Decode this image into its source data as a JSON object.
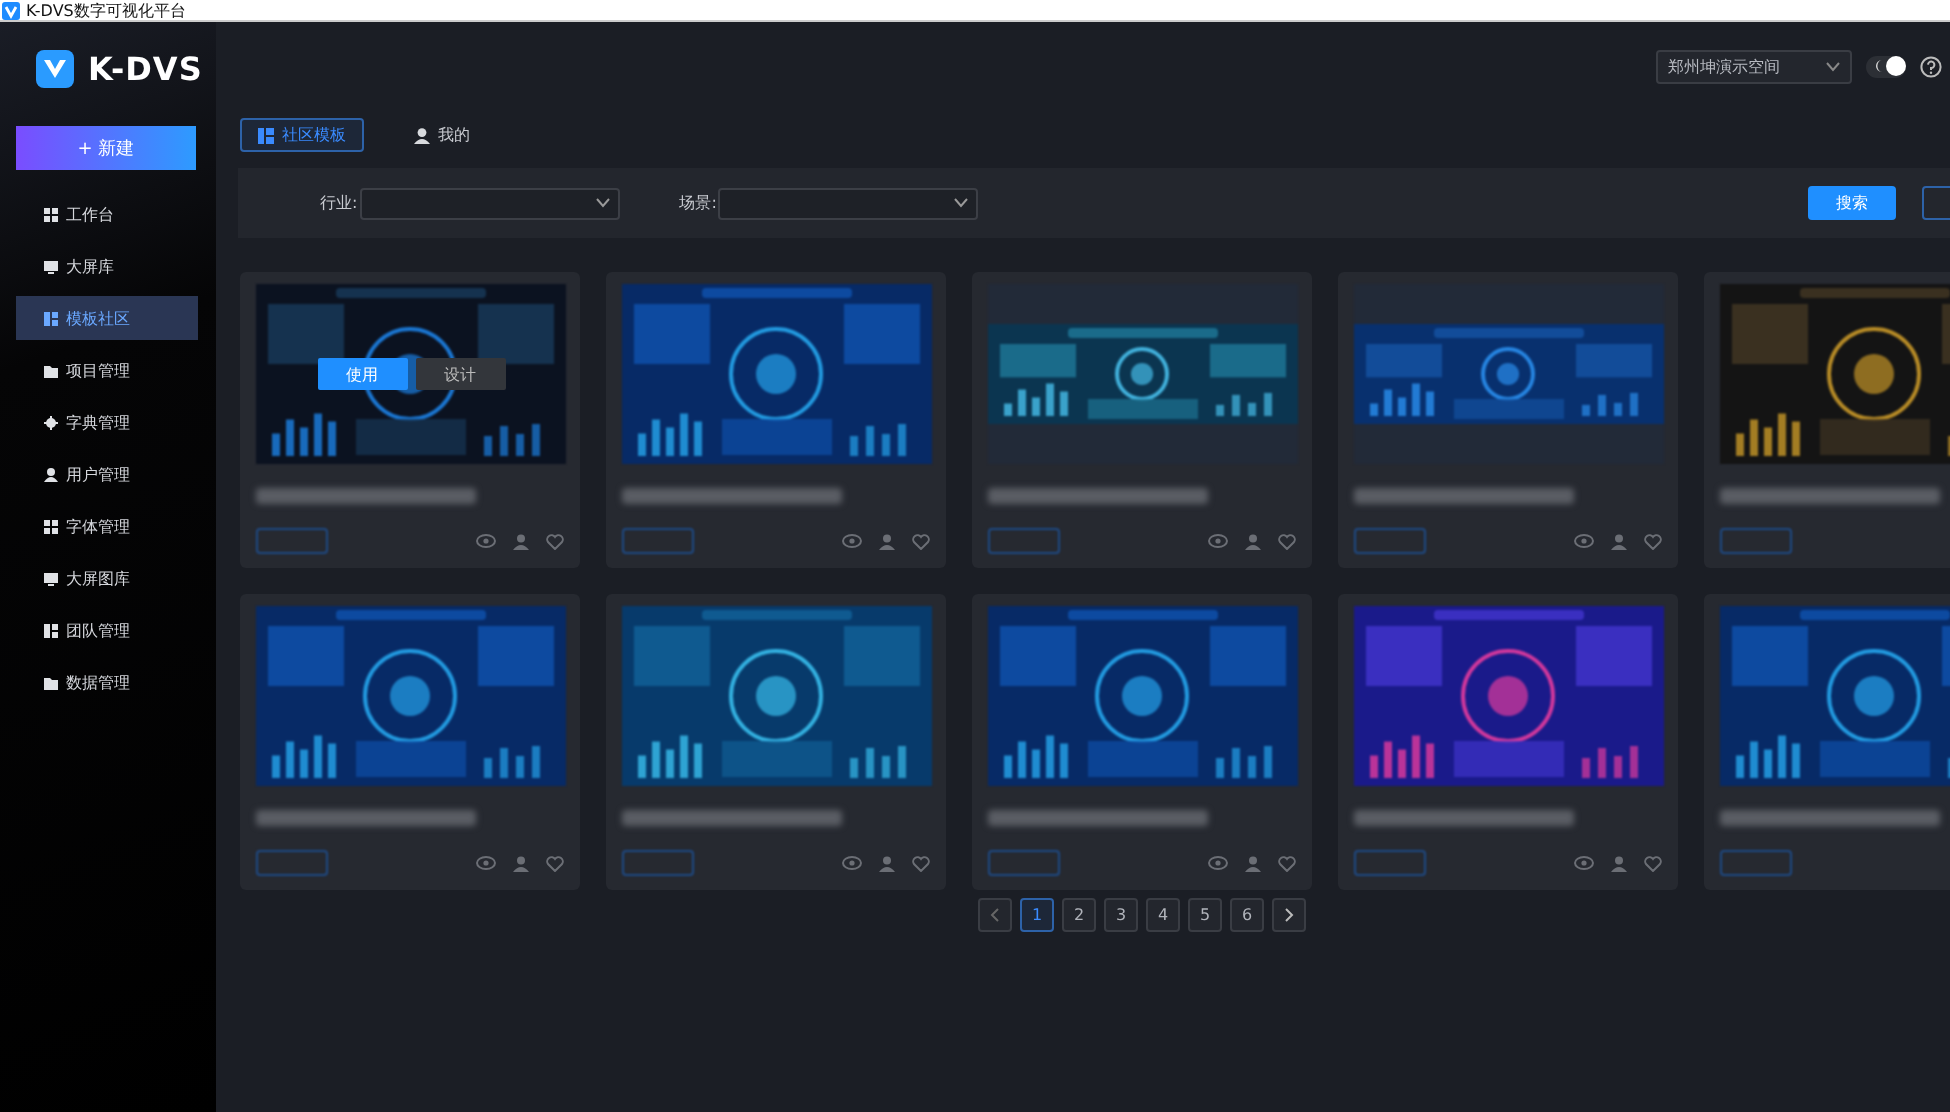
{
  "window": {
    "title": "K-DVS数字可视化平台"
  },
  "sidebar": {
    "logo": "K-DVS",
    "new_button": "+ 新建",
    "items": [
      {
        "label": "工作台",
        "selected": false
      },
      {
        "label": "大屏库",
        "selected": false
      },
      {
        "label": "模板社区",
        "selected": true
      },
      {
        "label": "项目管理",
        "selected": false
      },
      {
        "label": "字典管理",
        "selected": false
      },
      {
        "label": "用户管理",
        "selected": false
      },
      {
        "label": "字体管理",
        "selected": false
      },
      {
        "label": "大屏图库",
        "selected": false
      },
      {
        "label": "团队管理",
        "selected": false
      },
      {
        "label": "数据管理",
        "selected": false
      }
    ]
  },
  "header": {
    "workspace": "郑州坤演示空间",
    "dark_mode": true
  },
  "tabs": [
    {
      "label": "社区模板",
      "selected": true
    },
    {
      "label": "我的",
      "selected": false
    }
  ],
  "filters": [
    {
      "label": "行业:"
    },
    {
      "label": "场景:"
    }
  ],
  "search_button": "搜索",
  "cards": [
    {
      "kind": "dark",
      "actions": [
        "使用",
        "设计"
      ]
    },
    {
      "kind": "blue"
    },
    {
      "kind": "map"
    },
    {
      "kind": "wide"
    },
    {
      "kind": "gold"
    },
    {
      "kind": "blue"
    },
    {
      "kind": "teal"
    },
    {
      "kind": "blue"
    },
    {
      "kind": "magenta"
    },
    {
      "kind": "blue"
    }
  ],
  "pagination": {
    "pages": [
      {
        "label": "1",
        "selected": true
      },
      {
        "label": "2",
        "selected": false
      },
      {
        "label": "3",
        "selected": false
      },
      {
        "label": "4",
        "selected": false
      },
      {
        "label": "5",
        "selected": false
      },
      {
        "label": "6",
        "selected": false
      }
    ]
  }
}
